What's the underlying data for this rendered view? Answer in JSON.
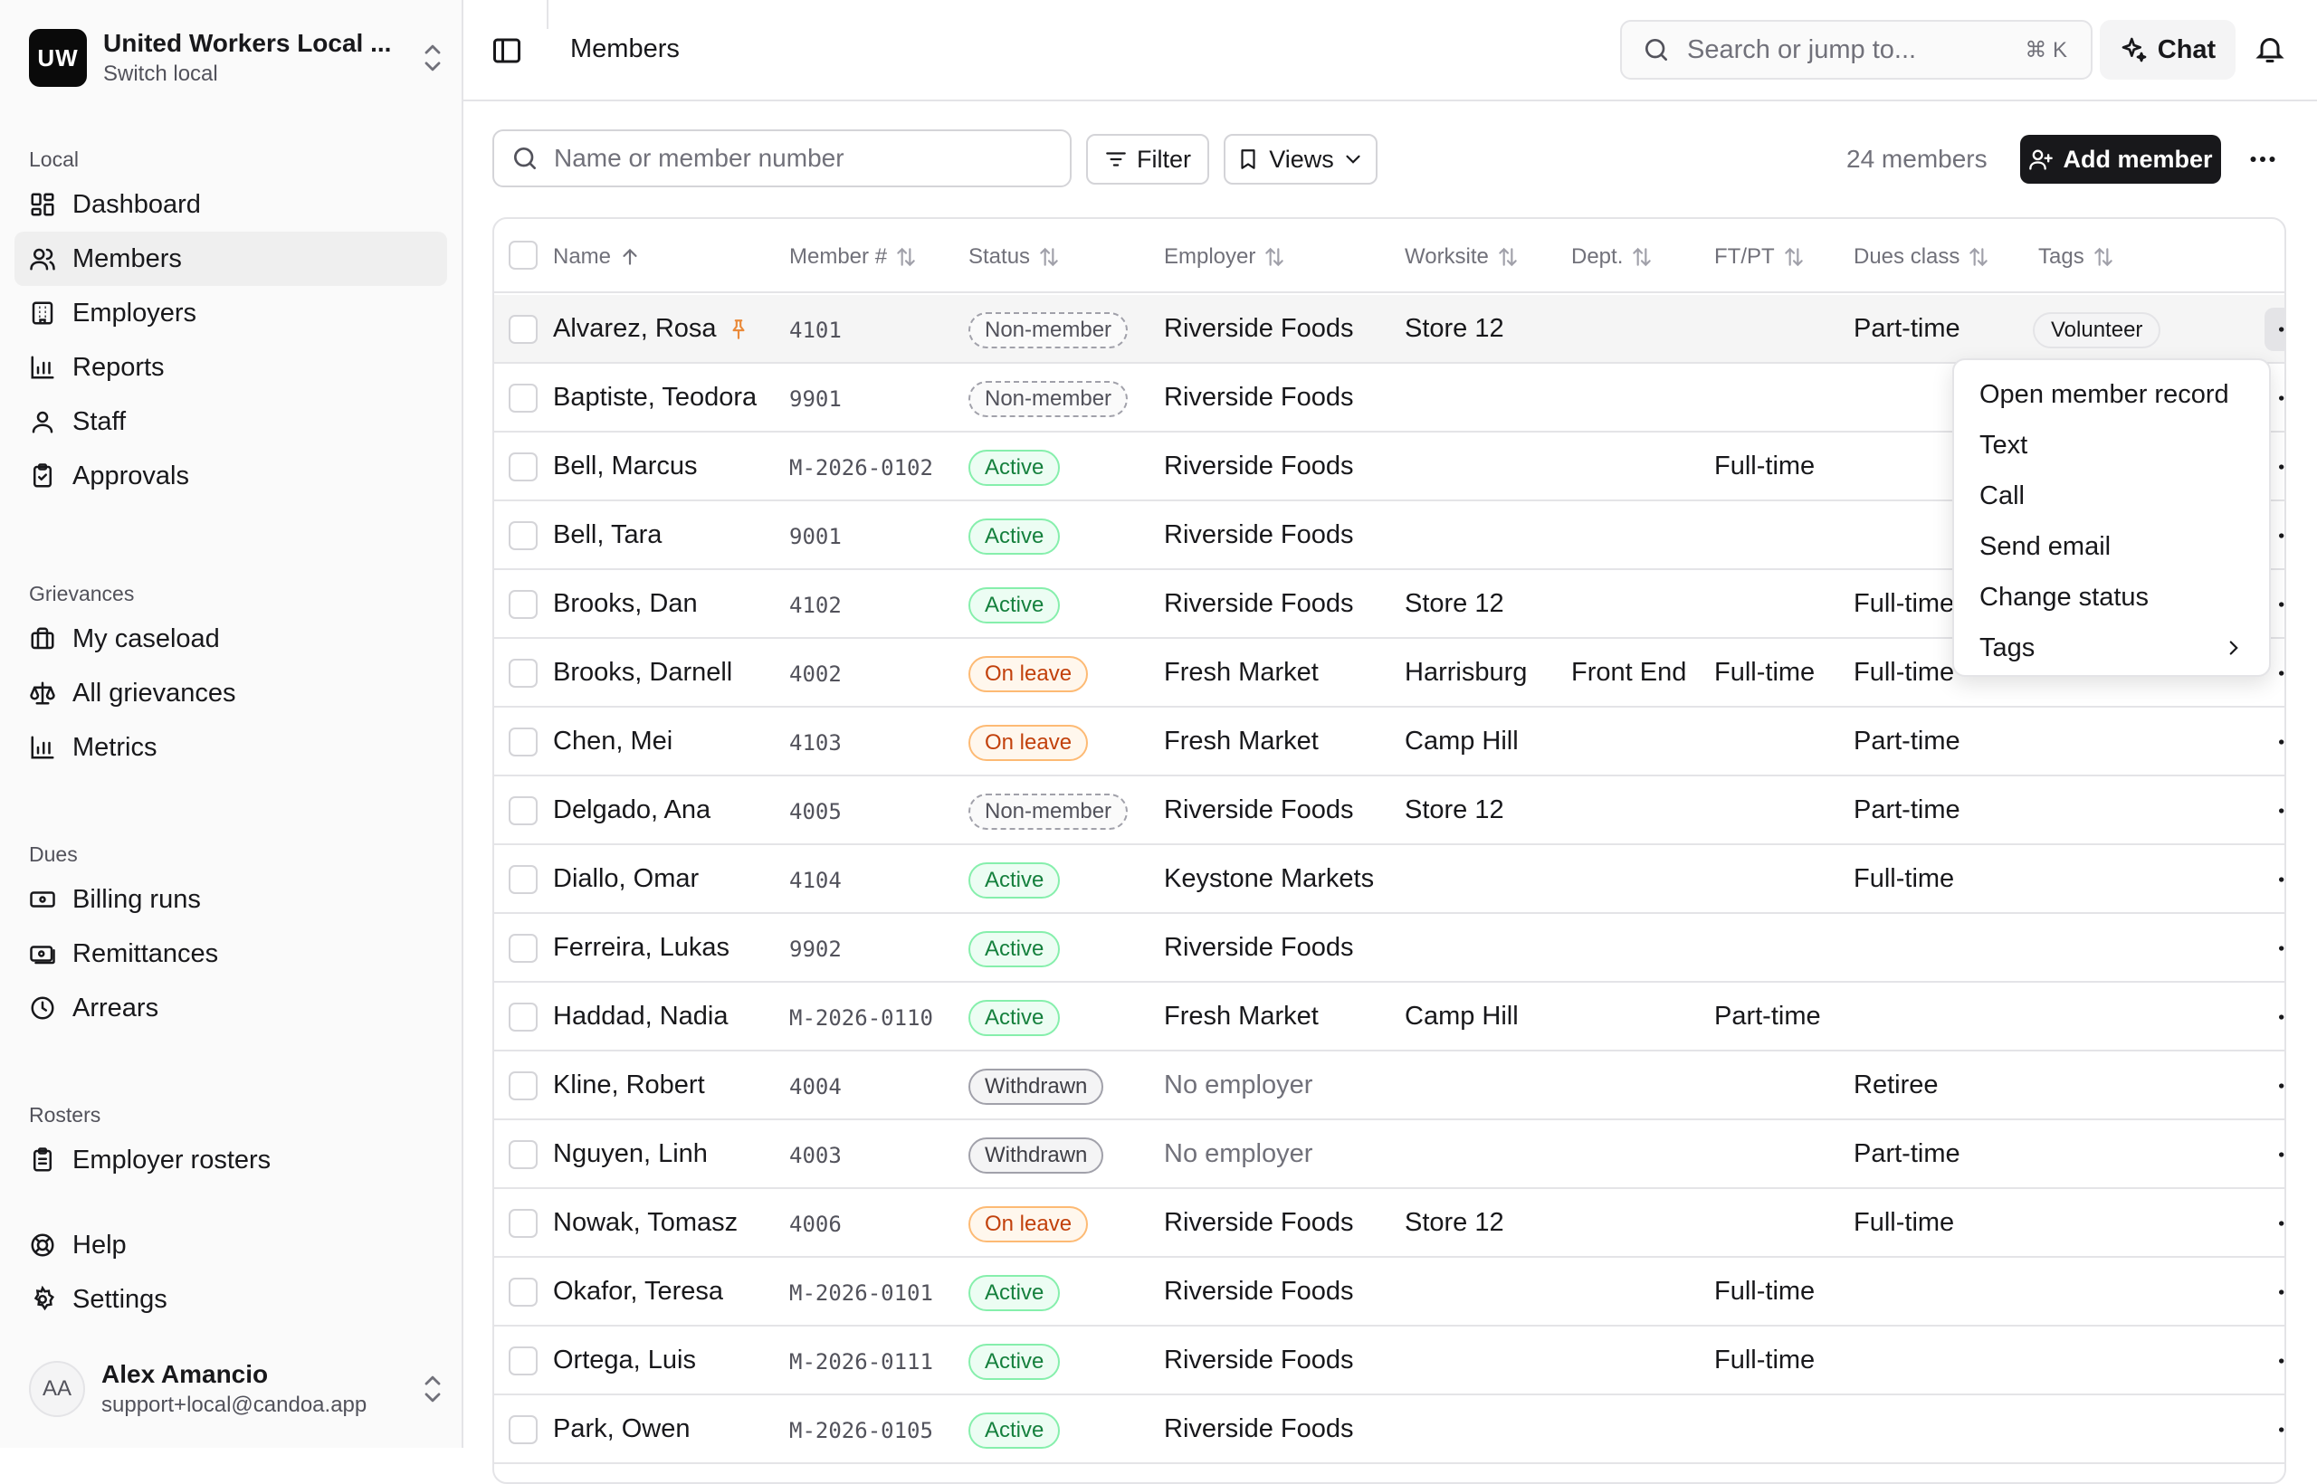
{
  "org": {
    "initials": "UW",
    "name": "United Workers Local ...",
    "subtitle": "Switch local"
  },
  "nav": {
    "local_heading": "Local",
    "local_items": [
      "Dashboard",
      "Members",
      "Employers",
      "Reports",
      "Staff",
      "Approvals"
    ],
    "grievances_heading": "Grievances",
    "grievances_items": [
      "My caseload",
      "All grievances",
      "Metrics"
    ],
    "dues_heading": "Dues",
    "dues_items": [
      "Billing runs",
      "Remittances",
      "Arrears"
    ],
    "rosters_heading": "Rosters",
    "rosters_items": [
      "Employer rosters"
    ],
    "footer_items": [
      "Help",
      "Settings"
    ]
  },
  "user": {
    "initials": "AA",
    "name": "Alex Amancio",
    "email": "support+local@candoa.app"
  },
  "header": {
    "title": "Members",
    "search_placeholder": "Search or jump to...",
    "shortcut": "⌘ K",
    "chat_label": "Chat"
  },
  "toolbar": {
    "search_placeholder": "Name or member number",
    "filter_label": "Filter",
    "views_label": "Views",
    "count": "24 members",
    "add_label": "Add member"
  },
  "table": {
    "headers": [
      "Name",
      "Member #",
      "Status",
      "Employer",
      "Worksite",
      "Dept.",
      "FT/PT",
      "Dues class",
      "Tags"
    ],
    "rows": [
      {
        "name": "Alvarez, Rosa",
        "num": "4101",
        "status": "Non-member",
        "employer": "Riverside Foods",
        "worksite": "Store 12",
        "dept": "",
        "ftpt": "",
        "dues": "Part-time",
        "tag": "Volunteer"
      },
      {
        "name": "Baptiste, Teodora",
        "num": "9901",
        "status": "Non-member",
        "employer": "Riverside Foods",
        "worksite": "",
        "dept": "",
        "ftpt": "",
        "dues": "",
        "tag": ""
      },
      {
        "name": "Bell, Marcus",
        "num": "M-2026-0102",
        "status": "Active",
        "employer": "Riverside Foods",
        "worksite": "",
        "dept": "",
        "ftpt": "Full-time",
        "dues": "",
        "tag": ""
      },
      {
        "name": "Bell, Tara",
        "num": "9001",
        "status": "Active",
        "employer": "Riverside Foods",
        "worksite": "",
        "dept": "",
        "ftpt": "",
        "dues": "",
        "tag": ""
      },
      {
        "name": "Brooks, Dan",
        "num": "4102",
        "status": "Active",
        "employer": "Riverside Foods",
        "worksite": "Store 12",
        "dept": "",
        "ftpt": "",
        "dues": "Full-time",
        "tag": ""
      },
      {
        "name": "Brooks, Darnell",
        "num": "4002",
        "status": "On leave",
        "employer": "Fresh Market",
        "worksite": "Harrisburg",
        "dept": "Front End",
        "ftpt": "Full-time",
        "dues": "Full-time",
        "tag": ""
      },
      {
        "name": "Chen, Mei",
        "num": "4103",
        "status": "On leave",
        "employer": "Fresh Market",
        "worksite": "Camp Hill",
        "dept": "",
        "ftpt": "",
        "dues": "Part-time",
        "tag": ""
      },
      {
        "name": "Delgado, Ana",
        "num": "4005",
        "status": "Non-member",
        "employer": "Riverside Foods",
        "worksite": "Store 12",
        "dept": "",
        "ftpt": "",
        "dues": "Part-time",
        "tag": ""
      },
      {
        "name": "Diallo, Omar",
        "num": "4104",
        "status": "Active",
        "employer": "Keystone Markets",
        "worksite": "",
        "dept": "",
        "ftpt": "",
        "dues": "Full-time",
        "tag": ""
      },
      {
        "name": "Ferreira, Lukas",
        "num": "9902",
        "status": "Active",
        "employer": "Riverside Foods",
        "worksite": "",
        "dept": "",
        "ftpt": "",
        "dues": "",
        "tag": ""
      },
      {
        "name": "Haddad, Nadia",
        "num": "M-2026-0110",
        "status": "Active",
        "employer": "Fresh Market",
        "worksite": "Camp Hill",
        "dept": "",
        "ftpt": "Part-time",
        "dues": "",
        "tag": ""
      },
      {
        "name": "Kline, Robert",
        "num": "4004",
        "status": "Withdrawn",
        "employer": "No employer",
        "worksite": "",
        "dept": "",
        "ftpt": "",
        "dues": "Retiree",
        "tag": ""
      },
      {
        "name": "Nguyen, Linh",
        "num": "4003",
        "status": "Withdrawn",
        "employer": "No employer",
        "worksite": "",
        "dept": "",
        "ftpt": "",
        "dues": "Part-time",
        "tag": ""
      },
      {
        "name": "Nowak, Tomasz",
        "num": "4006",
        "status": "On leave",
        "employer": "Riverside Foods",
        "worksite": "Store 12",
        "dept": "",
        "ftpt": "",
        "dues": "Full-time",
        "tag": ""
      },
      {
        "name": "Okafor, Teresa",
        "num": "M-2026-0101",
        "status": "Active",
        "employer": "Riverside Foods",
        "worksite": "",
        "dept": "",
        "ftpt": "Full-time",
        "dues": "",
        "tag": ""
      },
      {
        "name": "Ortega, Luis",
        "num": "M-2026-0111",
        "status": "Active",
        "employer": "Riverside Foods",
        "worksite": "",
        "dept": "",
        "ftpt": "Full-time",
        "dues": "",
        "tag": ""
      },
      {
        "name": "Park, Owen",
        "num": "M-2026-0105",
        "status": "Active",
        "employer": "Riverside Foods",
        "worksite": "",
        "dept": "",
        "ftpt": "",
        "dues": "",
        "tag": ""
      }
    ]
  },
  "context_menu": {
    "items": [
      "Open member record",
      "Text",
      "Call",
      "Send email",
      "Change status",
      "Tags"
    ]
  }
}
